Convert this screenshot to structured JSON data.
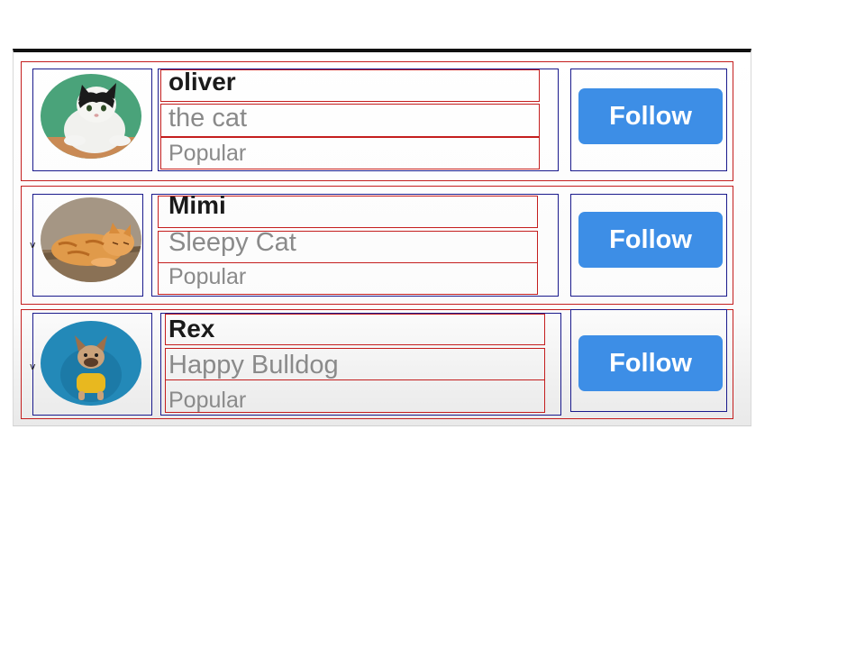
{
  "profiles": [
    {
      "name": "oliver",
      "subtitle": "the cat",
      "tag": "Popular",
      "button_label": "Follow",
      "avatar_icon": "tuxedo-cat-photo",
      "avatar_bg": "#4aa37a"
    },
    {
      "name": "Mimi",
      "subtitle": "Sleepy Cat",
      "tag": "Popular",
      "button_label": "Follow",
      "avatar_icon": "orange-tabby-cat-photo",
      "avatar_bg": "#9a8a78"
    },
    {
      "name": "Rex",
      "subtitle": "Happy Bulldog",
      "tag": "Popular",
      "button_label": "Follow",
      "avatar_icon": "french-bulldog-photo",
      "avatar_bg": "#2389b8"
    }
  ],
  "colors": {
    "button": "#3d8ee6",
    "name_text": "#1a1a1a",
    "secondary_text": "#8a8a8a"
  }
}
